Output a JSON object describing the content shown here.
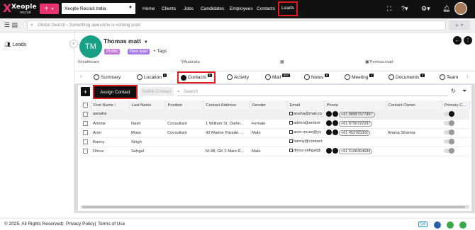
{
  "header": {
    "logo_text": "Xeople",
    "logo_sub": "recruit",
    "plus_label": "+",
    "org_selected": "Xeople Recruit India",
    "nav": [
      "Home",
      "Clients",
      "Jobs",
      "Candidates",
      "Employees",
      "Contacts",
      "Leads"
    ],
    "active_nav": "Leads"
  },
  "subbar": {
    "search_placeholder": "Global Search - Something awesome is coming soon",
    "add_label": "+"
  },
  "sidebar": {
    "items": [
      {
        "label": "Leads",
        "icon": "users-icon"
      }
    ]
  },
  "profile": {
    "initials": "TM",
    "name": "Thomas matt",
    "tags": [
      "Public",
      "New lead"
    ],
    "tags_button": "Tags",
    "industry": "Healthcare",
    "location": "Australia",
    "owner_field": "Thomas.matt"
  },
  "tabs": [
    {
      "label": "Summary",
      "badge": ""
    },
    {
      "label": "Location",
      "badge": "1"
    },
    {
      "label": "Contacts",
      "badge": "5"
    },
    {
      "label": "Activity",
      "badge": ""
    },
    {
      "label": "Mail",
      "badge": "693"
    },
    {
      "label": "Notes",
      "badge": "8"
    },
    {
      "label": "Meeting",
      "badge": "1"
    },
    {
      "label": "Documents",
      "badge": "2"
    },
    {
      "label": "Team",
      "badge": ""
    }
  ],
  "active_tab": "Contacts",
  "toolbar": {
    "assign_label": "Assign Contact",
    "delink_label": "Delink Contact",
    "search_placeholder": "Search"
  },
  "table": {
    "columns": [
      "First Name",
      "Last Name",
      "Position",
      "Contact Address",
      "Gender",
      "Email",
      "Phone",
      "Contact Owner",
      "Primary C..."
    ],
    "rows": [
      {
        "first": "aanaha",
        "last": "",
        "position": "",
        "address": "",
        "gender": "",
        "email": "anaha@mail.co",
        "phone": "+91 88887877887",
        "owner": "",
        "primary": true
      },
      {
        "first": "Ammie",
        "last": "Nash",
        "position": "Consultant",
        "address": "1 William St, Darlin...",
        "gender": "Female",
        "email": "admin@entirer",
        "phone": "+91 8790722287",
        "owner": "",
        "primary": false
      },
      {
        "first": "Aron",
        "last": "Muse",
        "position": "Consultant",
        "address": "42 Marine Parade, ...",
        "gender": "Male",
        "email": "aron.muse@ys",
        "phone": "+61 453783300",
        "owner": "Ahana Sharma",
        "primary": false
      },
      {
        "first": "Banny",
        "last": "Singh",
        "position": "",
        "address": "",
        "gender": "",
        "email": "banny@contact",
        "phone": "",
        "owner": "",
        "primary": false
      },
      {
        "first": "Dhruv",
        "last": "Sehgal",
        "position": "",
        "address": "M-38, GK 2 Main R...",
        "gender": "Male",
        "email": "dhruv.sehgal@",
        "phone": "+91 5168464684",
        "owner": "",
        "primary": false
      }
    ]
  },
  "footer": {
    "copyright": "© 2025. All Rights Reserved",
    "privacy": "Privacy Policy",
    "terms": "Terms of Use",
    "env_badge": "QA"
  },
  "colors": {
    "brand": "#e8336e",
    "highlight": "#e21c1c",
    "avatar": "#17a085"
  }
}
